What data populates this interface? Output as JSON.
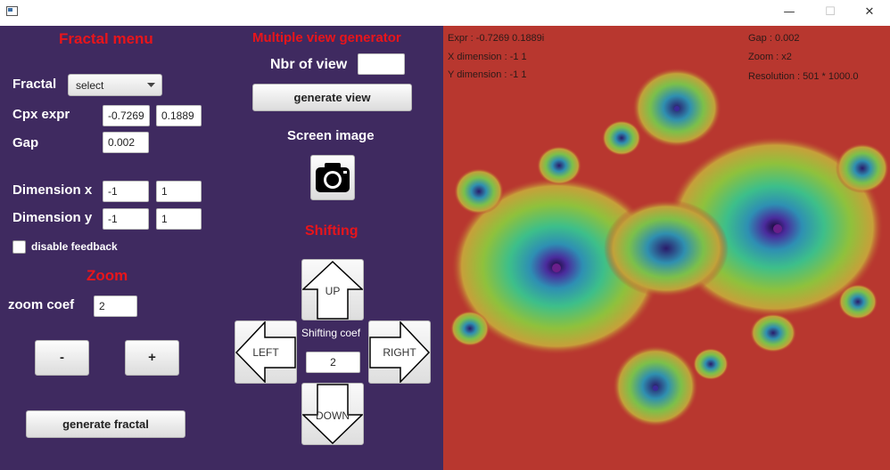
{
  "window": {
    "title": "",
    "minimize": "—",
    "maximize": "☐",
    "close": "✕"
  },
  "fractal_menu": {
    "title": "Fractal menu",
    "fractal_label": "Fractal",
    "fractal_select_value": "select",
    "cpx_label": "Cpx expr",
    "cpx_real": "-0.7269",
    "cpx_imag": "0.1889",
    "gap_label": "Gap",
    "gap_value": "0.002",
    "dimx_label": "Dimension x",
    "dimx_min": "-1",
    "dimx_max": "1",
    "dimy_label": "Dimension y",
    "dimy_min": "-1",
    "dimy_max": "1",
    "feedback_label": "disable feedback",
    "feedback_checked": false
  },
  "zoom": {
    "title": "Zoom",
    "coef_label": "zoom coef",
    "coef_value": "2",
    "minus_label": "-",
    "plus_label": "+"
  },
  "generate_fractal_label": "generate fractal",
  "multiple_view": {
    "title": "Multiple view generator",
    "nbr_label": "Nbr of view",
    "nbr_value": "",
    "generate_label": "generate view"
  },
  "screen_image": {
    "title": "Screen image",
    "icon": "camera-icon"
  },
  "shifting": {
    "title": "Shifting",
    "up_label": "UP",
    "down_label": "DOWN",
    "left_label": "LEFT",
    "right_label": "RIGHT",
    "coef_label": "Shifting coef",
    "coef_value": "2"
  },
  "fractal_info": {
    "expr": "Expr : -0.7269 0.1889i",
    "xdim": "X dimension : -1 1",
    "ydim": "Y dimension : -1 1",
    "gap": "Gap : 0.002",
    "zoom": "Zoom : x2",
    "resolution": "Resolution : 501 * 1000.0"
  },
  "colors": {
    "panel_bg": "#3f2a60",
    "title_red": "#e8151b",
    "fractal_bg": "#b8372f"
  }
}
